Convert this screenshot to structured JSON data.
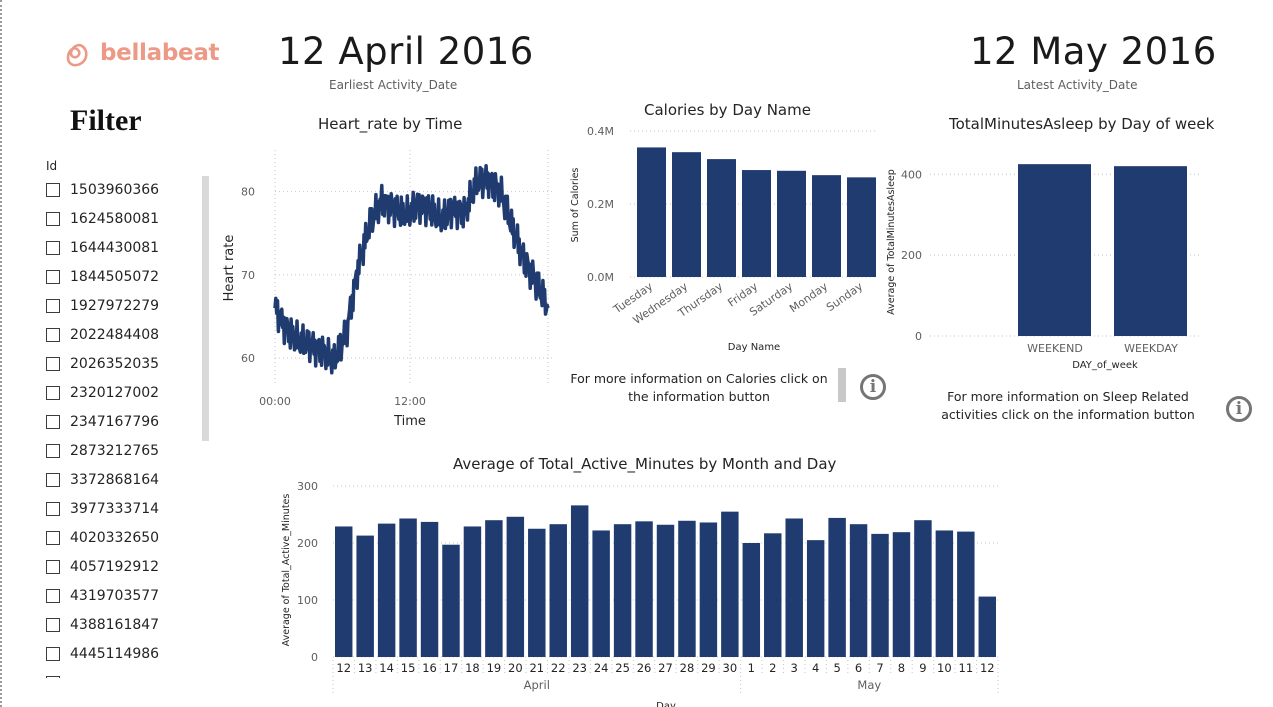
{
  "brand": {
    "name": "bellabeat",
    "icon": "bellabeat-logo-icon",
    "color": "#ec9a86"
  },
  "filter": {
    "title": "Filter",
    "slicer_header": "Id",
    "ids": [
      "1503960366",
      "1624580081",
      "1644430081",
      "1844505072",
      "1927972279",
      "2022484408",
      "2026352035",
      "2320127002",
      "2347167796",
      "2873212765",
      "3372868164",
      "3977333714",
      "4020332650",
      "4057192912",
      "4319703577",
      "4388161847",
      "4445114986"
    ]
  },
  "cards": {
    "earliest": {
      "value": "12 April 2016",
      "label": "Earliest Activity_Date"
    },
    "latest": {
      "value": "12 May 2016",
      "label": "Latest Activity_Date"
    }
  },
  "info": {
    "calories": "For more information on Calories click on the information button",
    "sleep": "For more information on Sleep Related activities click on the information button",
    "button_icon": "info-icon"
  },
  "colors": {
    "bar": "#1f3b70",
    "line": "#1f3b70",
    "grid": "#c8c6c4",
    "axis_text": "#605e5c"
  },
  "chart_data": [
    {
      "id": "heart",
      "type": "line",
      "title": "Heart_rate by Time",
      "xlabel": "Time",
      "ylabel": "Heart rate",
      "x_ticks": [
        "00:00",
        "12:00"
      ],
      "y_ticks": [
        60,
        70,
        80
      ],
      "ylim": [
        57,
        85
      ],
      "x": [
        0,
        1,
        2,
        3,
        4,
        5,
        6,
        7,
        8,
        9,
        10,
        11,
        12,
        13,
        14,
        15,
        16,
        17,
        18,
        19,
        20,
        21,
        22,
        23
      ],
      "values": [
        66,
        63.5,
        62,
        61.5,
        61,
        59.5,
        63,
        71,
        76,
        79,
        78,
        77,
        78.5,
        78,
        76.5,
        78,
        77.5,
        81,
        81.5,
        80,
        75.5,
        72,
        69,
        66
      ],
      "grid": true
    },
    {
      "id": "calories",
      "type": "bar",
      "title": "Calories by Day Name",
      "xlabel": "Day Name",
      "ylabel": "Sum of Calories",
      "categories": [
        "Tuesday",
        "Wednesday",
        "Thursday",
        "Friday",
        "Saturday",
        "Monday",
        "Sunday"
      ],
      "values": [
        355000,
        342000,
        323000,
        293000,
        291000,
        279000,
        273000
      ],
      "y_ticks": [
        "0.0M",
        "0.2M",
        "0.4M"
      ],
      "ylim": [
        0,
        400000
      ],
      "grid": true
    },
    {
      "id": "sleep",
      "type": "bar",
      "title": "TotalMinutesAsleep by Day of week",
      "xlabel": "DAY_of_week",
      "ylabel": "Average of TotalMinutesAsleep",
      "categories": [
        "WEEKEND",
        "WEEKDAY"
      ],
      "values": [
        425,
        420
      ],
      "y_ticks": [
        0,
        200,
        400
      ],
      "ylim": [
        0,
        460
      ],
      "grid": true
    },
    {
      "id": "active",
      "type": "bar",
      "title": "Average of Total_Active_Minutes by Month and Day",
      "xlabel": "Day",
      "ylabel": "Average of Total_Active_Minutes",
      "categories": [
        "12",
        "13",
        "14",
        "15",
        "16",
        "17",
        "18",
        "19",
        "20",
        "21",
        "22",
        "23",
        "24",
        "25",
        "26",
        "27",
        "28",
        "29",
        "30",
        "1",
        "2",
        "3",
        "4",
        "5",
        "6",
        "7",
        "8",
        "9",
        "10",
        "11",
        "12"
      ],
      "groups": [
        {
          "name": "April",
          "count": 19
        },
        {
          "name": "May",
          "count": 12
        }
      ],
      "values": [
        229,
        213,
        234,
        243,
        237,
        197,
        229,
        240,
        246,
        225,
        233,
        266,
        222,
        233,
        238,
        232,
        239,
        236,
        255,
        200,
        217,
        243,
        205,
        244,
        233,
        216,
        219,
        240,
        222,
        220,
        106
      ],
      "y_ticks": [
        0,
        100,
        200,
        300
      ],
      "ylim": [
        0,
        300
      ],
      "grid": true
    }
  ]
}
